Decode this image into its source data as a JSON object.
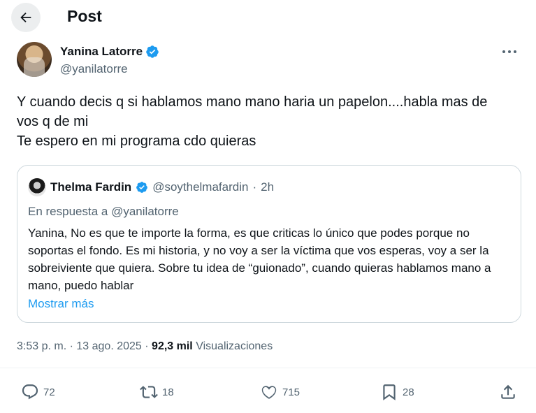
{
  "header": {
    "title": "Post"
  },
  "tweet": {
    "author_name": "Yanina Latorre",
    "author_handle": "@yanilatorre",
    "text": "Y cuando decis q si hablamos mano mano haria un papelon....habla mas de\nvos q de mi\nTe espero en mi programa cdo quieras",
    "time": "3:53 p. m.",
    "date": "13 ago. 2025",
    "views_count": "92,3 mil",
    "views_label": "Visualizaciones"
  },
  "quote": {
    "author_name": "Thelma Fardin",
    "author_handle": "@soythelmafardin",
    "age": "2h",
    "reply_prefix": "En respuesta a",
    "reply_handle": "@yanilatorre",
    "text": "Yanina, No es que te importe la forma, es que criticas lo único que podes porque no soportas el fondo. Es mi historia, y no voy a ser la víctima que vos esperas, voy a ser la sobreiviente que quiera. Sobre tu idea de “guionado”, cuando quieras hablamos mano a mano, puedo hablar",
    "show_more": "Mostrar más"
  },
  "actions": {
    "replies": "72",
    "reposts": "18",
    "likes": "715",
    "bookmarks": "28"
  },
  "colors": {
    "accent": "#1d9bf0",
    "muted": "#536471",
    "text": "#0f1419",
    "border": "#cfd9de"
  }
}
